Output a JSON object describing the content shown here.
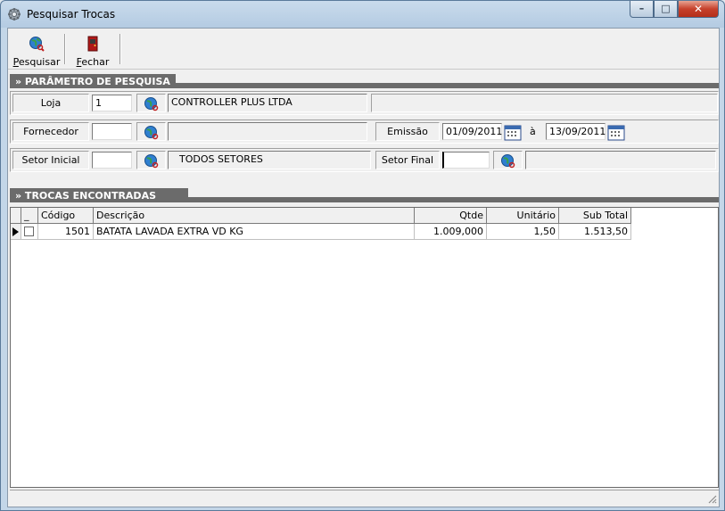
{
  "window": {
    "title": "Pesquisar Trocas",
    "controls": {
      "minimize": "–",
      "maximize": "□",
      "close": "✕"
    }
  },
  "toolbar": {
    "pesquisar": {
      "underline": "P",
      "rest": "esquisar",
      "icon": "globe-search-icon"
    },
    "fechar": {
      "underline": "F",
      "rest": "echar",
      "icon": "door-exit-icon"
    }
  },
  "params": {
    "header": "» PARÂMETRO DE PESQUISA",
    "loja": {
      "label": "Loja",
      "value": "1",
      "name": "CONTROLLER PLUS LTDA"
    },
    "fornecedor": {
      "label": "Fornecedor",
      "value": "",
      "name": ""
    },
    "emissao": {
      "label": "Emissão",
      "from": "01/09/2011",
      "sep": "à",
      "to": "13/09/2011"
    },
    "setor_inicial": {
      "label": "Setor Inicial",
      "value": "",
      "name": "TODOS SETORES"
    },
    "setor_final": {
      "label": "Setor Final",
      "value": "",
      "name": ""
    }
  },
  "results": {
    "header": "» TROCAS ENCONTRADAS",
    "columns": [
      "_",
      "Código",
      "Descrição",
      "Qtde",
      "Unitário",
      "Sub Total"
    ],
    "rows": [
      {
        "codigo": "1501",
        "descricao": "BATATA LAVADA EXTRA VD KG",
        "qtde": "1.009,000",
        "unitario": "1,50",
        "subtotal": "1.513,50"
      }
    ]
  },
  "colors": {
    "section_header": "#6b6b6b",
    "title_bar": "#c9dbec",
    "close_button": "#c6412c"
  }
}
